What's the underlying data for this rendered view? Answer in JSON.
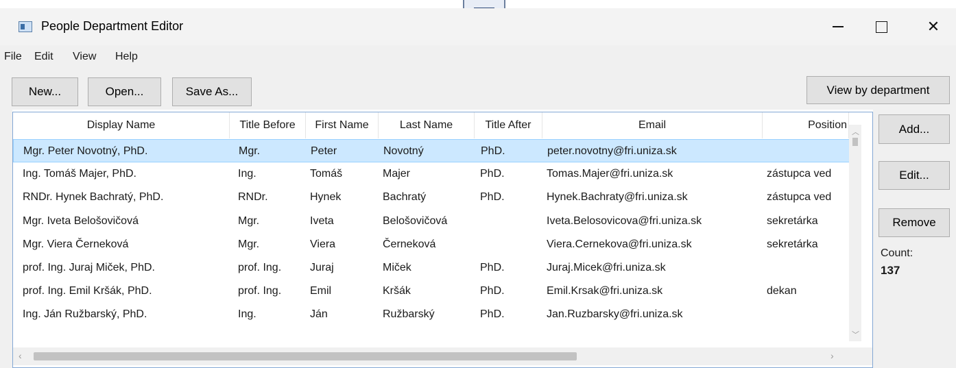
{
  "window": {
    "title": "People Department Editor"
  },
  "menu": {
    "file": "File",
    "edit": "Edit",
    "view": "View",
    "help": "Help"
  },
  "toolbar": {
    "new": "New...",
    "open": "Open...",
    "save_as": "Save As...",
    "view_by_department": "View by department"
  },
  "side": {
    "add": "Add...",
    "edit": "Edit...",
    "remove": "Remove",
    "count_label": "Count:",
    "count_value": "137"
  },
  "columns": [
    "Display Name",
    "Title Before",
    "First Name",
    "Last Name",
    "Title After",
    "Email",
    "Position"
  ],
  "rows": [
    [
      "Mgr. Peter Novotný, PhD.",
      "Mgr.",
      "Peter",
      "Novotný",
      "PhD.",
      "peter.novotny@fri.uniza.sk",
      ""
    ],
    [
      "Ing. Tomáš Majer, PhD.",
      "Ing.",
      "Tomáš",
      "Majer",
      "PhD.",
      "Tomas.Majer@fri.uniza.sk",
      "zástupca ved"
    ],
    [
      "RNDr. Hynek Bachratý, PhD.",
      "RNDr.",
      "Hynek",
      "Bachratý",
      "PhD.",
      "Hynek.Bachraty@fri.uniza.sk",
      "zástupca ved"
    ],
    [
      "Mgr. Iveta Belošovičová",
      "Mgr.",
      "Iveta",
      "Belošovičová",
      "",
      "Iveta.Belosovicova@fri.uniza.sk",
      "sekretárka"
    ],
    [
      "Mgr. Viera Černeková",
      "Mgr.",
      "Viera",
      "Černeková",
      "",
      "Viera.Cernekova@fri.uniza.sk",
      "sekretárka"
    ],
    [
      "prof. Ing. Juraj Miček, PhD.",
      "prof. Ing.",
      "Juraj",
      "Miček",
      "PhD.",
      "Juraj.Micek@fri.uniza.sk",
      ""
    ],
    [
      "prof. Ing. Emil Kršák, PhD.",
      "prof. Ing.",
      "Emil",
      "Kršák",
      "PhD.",
      "Emil.Krsak@fri.uniza.sk",
      "dekan"
    ],
    [
      "Ing. Ján Ružbarský, PhD.",
      "Ing.",
      "Ján",
      "Ružbarský",
      "PhD.",
      "Jan.Ruzbarsky@fri.uniza.sk",
      ""
    ]
  ],
  "selected_row": 0,
  "colors": {
    "selection": "#cce8ff",
    "selection_border": "#99d1ff",
    "grid_border": "#82a7d4"
  },
  "icons": {
    "app": "app-window-icon",
    "minimize": "minimize-icon",
    "maximize": "maximize-icon",
    "close": "close-icon"
  }
}
